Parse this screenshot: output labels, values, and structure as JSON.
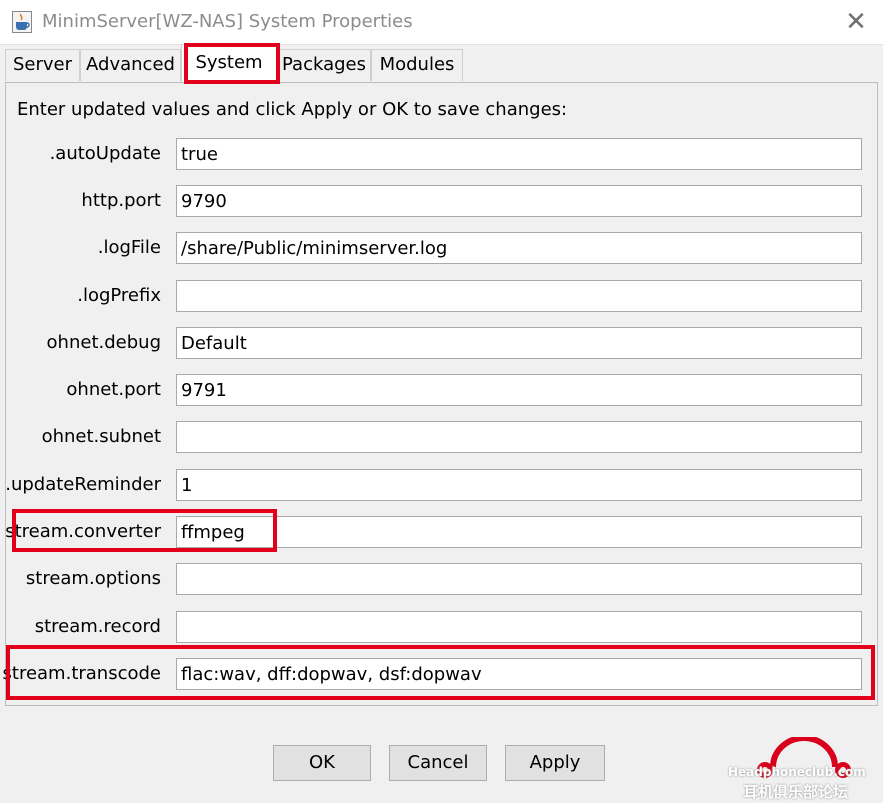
{
  "window": {
    "title": "MinimServer[WZ-NAS] System Properties",
    "close_glyph": "✕",
    "app_icon": "java-cup-icon"
  },
  "tabs": [
    {
      "label": "Server"
    },
    {
      "label": "Advanced"
    },
    {
      "label": "System"
    },
    {
      "label": "Packages"
    },
    {
      "label": "Modules"
    }
  ],
  "active_tab": "System",
  "instructions": "Enter updated values and click Apply or OK to save changes:",
  "properties": [
    {
      "label": ".autoUpdate",
      "value": "true"
    },
    {
      "label": "http.port",
      "value": "9790"
    },
    {
      "label": ".logFile",
      "value": "/share/Public/minimserver.log"
    },
    {
      "label": ".logPrefix",
      "value": ""
    },
    {
      "label": "ohnet.debug",
      "value": "Default"
    },
    {
      "label": "ohnet.port",
      "value": "9791"
    },
    {
      "label": "ohnet.subnet",
      "value": ""
    },
    {
      "label": ".updateReminder",
      "value": "1"
    },
    {
      "label": "stream.converter",
      "value": "ffmpeg"
    },
    {
      "label": "stream.options",
      "value": ""
    },
    {
      "label": "stream.record",
      "value": ""
    },
    {
      "label": "stream.transcode",
      "value": "flac:wav, dff:dopwav, dsf:dopwav"
    }
  ],
  "buttons": {
    "ok": "OK",
    "cancel": "Cancel",
    "apply": "Apply"
  },
  "watermark": {
    "text_en": "Headphoneclub.com",
    "text_cn": "耳机俱乐部论坛"
  },
  "colors": {
    "highlight": "#e3001b",
    "background": "#f0f0f0"
  }
}
